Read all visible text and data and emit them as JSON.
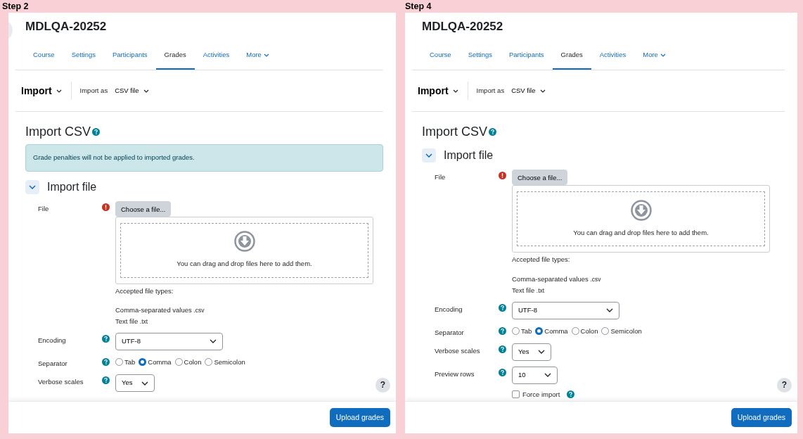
{
  "panels": [
    {
      "step_label": "Step 2",
      "drawer_toggle": true,
      "course_title": "MDLQA-20252",
      "tabs": [
        {
          "label": "Course",
          "selected": false
        },
        {
          "label": "Settings",
          "selected": false
        },
        {
          "label": "Participants",
          "selected": false
        },
        {
          "label": "Grades",
          "selected": true
        },
        {
          "label": "Activities",
          "selected": false
        },
        {
          "label": "More",
          "selected": false,
          "dropdown": true
        }
      ],
      "tertiary": {
        "title": "Import",
        "import_as_label": "Import as",
        "import_as_value": "CSV file"
      },
      "heading": "Import CSV",
      "notice": "Grade penalties will not be applied to imported grades.",
      "section": {
        "title": "Import file",
        "expanded": true
      },
      "fields": [
        {
          "kind": "filepicker",
          "label": "File",
          "required": true,
          "button": "Choose a file...",
          "drop_text": "You can drag and drop files here to add them.",
          "accepted_label": "Accepted file types:",
          "types": [
            {
              "name": "Comma-separated values",
              "ext": ".csv"
            },
            {
              "name": "Text file",
              "ext": ".txt"
            }
          ]
        },
        {
          "kind": "dropdown",
          "label": "Encoding",
          "required": false,
          "value": "UTF-8"
        },
        {
          "kind": "radio",
          "label": "Separator",
          "required": false,
          "options": [
            {
              "label": "Tab",
              "selected": false
            },
            {
              "label": "Comma",
              "selected": true
            },
            {
              "label": "Colon",
              "selected": false
            },
            {
              "label": "Semicolon",
              "selected": false
            }
          ]
        },
        {
          "kind": "select",
          "label": "Verbose scales",
          "required": false,
          "value": "Yes"
        }
      ],
      "help_button": "?",
      "submit": "Upload grades"
    },
    {
      "step_label": "Step 4",
      "drawer_toggle": false,
      "course_title": "MDLQA-20252",
      "tabs": [
        {
          "label": "Course",
          "selected": false
        },
        {
          "label": "Settings",
          "selected": false
        },
        {
          "label": "Participants",
          "selected": false
        },
        {
          "label": "Grades",
          "selected": true
        },
        {
          "label": "Activities",
          "selected": false
        },
        {
          "label": "More",
          "selected": false,
          "dropdown": true
        }
      ],
      "tertiary": {
        "title": "Import",
        "import_as_label": "Import as",
        "import_as_value": "CSV file"
      },
      "heading": "Import CSV",
      "section": {
        "title": "Import file",
        "expanded": true
      },
      "fields": [
        {
          "kind": "filepicker",
          "label": "File",
          "required": true,
          "button": "Choose a file...",
          "drop_text": "You can drag and drop files here to add them.",
          "accepted_label": "Accepted file types:",
          "types": [
            {
              "name": "Comma-separated values",
              "ext": ".csv"
            },
            {
              "name": "Text file",
              "ext": ".txt"
            }
          ]
        },
        {
          "kind": "dropdown",
          "label": "Encoding",
          "required": false,
          "value": "UTF-8"
        },
        {
          "kind": "radio",
          "label": "Separator",
          "required": false,
          "options": [
            {
              "label": "Tab",
              "selected": false
            },
            {
              "label": "Comma",
              "selected": true
            },
            {
              "label": "Colon",
              "selected": false
            },
            {
              "label": "Semicolon",
              "selected": false
            }
          ]
        },
        {
          "kind": "select",
          "label": "Verbose scales",
          "required": false,
          "value": "Yes"
        },
        {
          "kind": "select",
          "label": "Preview rows",
          "required": false,
          "value": "10"
        },
        {
          "kind": "checkbox",
          "label": "Force import",
          "checked": false
        }
      ],
      "help_button": "?",
      "submit": "Upload grades"
    }
  ]
}
